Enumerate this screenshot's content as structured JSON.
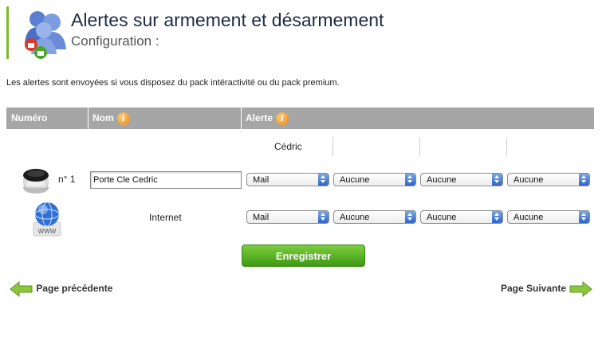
{
  "header": {
    "title": "Alertes sur armement et désarmement",
    "subtitle": "Configuration :"
  },
  "notice": "Les alertes sont envoyées si vous disposez du pack intéractivité ou du pack premium.",
  "table": {
    "columns": {
      "number": "Numéro",
      "name": "Nom",
      "alert": "Alerte"
    },
    "users": [
      "Cédric",
      "",
      "",
      ""
    ],
    "rows": [
      {
        "number": "n° 1",
        "name_value": "Porte Cle Cedric",
        "alerts": [
          "Mail",
          "Aucune",
          "Aucune",
          "Aucune"
        ],
        "icon": "keyfob-icon"
      },
      {
        "number": "",
        "name": "Internet",
        "alerts": [
          "Mail",
          "Aucune",
          "Aucune",
          "Aucune"
        ],
        "icon": "internet-globe-icon",
        "icon_label": "WWW"
      }
    ]
  },
  "actions": {
    "save_label": "Enregistrer"
  },
  "nav": {
    "prev_label": "Page précédente",
    "next_label": "Page Suivante"
  },
  "colors": {
    "accent_green": "#7dbb2c",
    "header_gray": "#a6a6a6",
    "button_green": "#4fa81c"
  }
}
